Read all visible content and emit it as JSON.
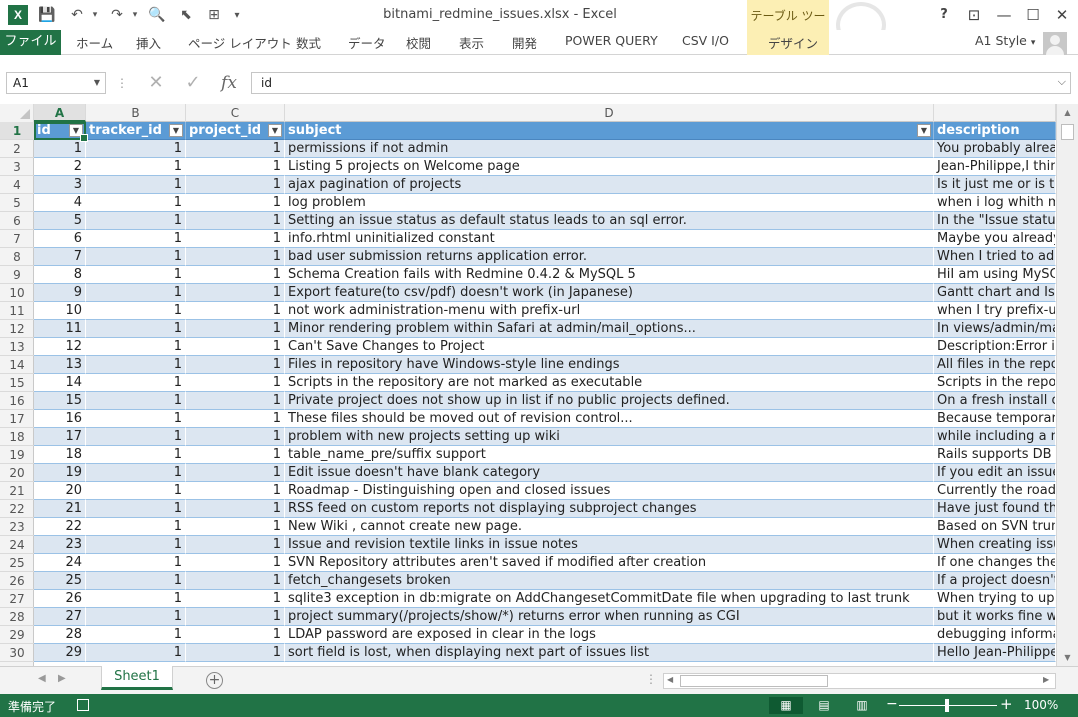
{
  "window": {
    "title": "bitnami_redmine_issues.xlsx - Excel",
    "context_tab_group": "テーブル ツール",
    "help": "?",
    "restore_ribbon": "⊡",
    "minimize": "—",
    "maximize": "☐",
    "close": "✕"
  },
  "quick_access": {
    "app_icon": "X",
    "save": "💾",
    "undo": "↶",
    "redo": "↷",
    "print_preview": "🔍",
    "select": "⬉",
    "screen": "⊞",
    "more": "▾"
  },
  "ribbon": {
    "file": "ファイル",
    "tabs": [
      "ホーム",
      "挿入",
      "ページ レイアウト",
      "数式",
      "データ",
      "校閲",
      "表示",
      "開発",
      "POWER QUERY",
      "CSV I/O",
      "デザイン"
    ],
    "style": "A1 Style",
    "style_arrow": "▾"
  },
  "formula_bar": {
    "name_box": "A1",
    "name_box_arrow": "▼",
    "sep": "⋮",
    "cancel": "✕",
    "enter": "✓",
    "fx": "fx",
    "value": "id",
    "expand": "⌵"
  },
  "grid": {
    "corner": "",
    "columns": [
      "A",
      "B",
      "C",
      "D",
      ""
    ],
    "active_column": "A",
    "active_row": 1,
    "row_numbers": [
      "1",
      "2",
      "3",
      "4",
      "5",
      "6",
      "7",
      "8",
      "9",
      "10",
      "11",
      "12",
      "13",
      "14",
      "15",
      "16",
      "17",
      "18",
      "19",
      "20",
      "21",
      "22",
      "23",
      "24",
      "25",
      "26",
      "27",
      "28",
      "29",
      "30"
    ],
    "headers": [
      "id",
      "tracker_id",
      "project_id",
      "subject",
      "description"
    ],
    "filter_arrow": "▼",
    "rows": [
      [
        "1",
        "1",
        "1",
        "permissions if not admin",
        "You probably alread"
      ],
      [
        "2",
        "1",
        "1",
        "Listing 5 projects on Welcome page",
        "Jean-Philippe,I thin"
      ],
      [
        "3",
        "1",
        "1",
        "ajax pagination of projects",
        "Is it just me or is t"
      ],
      [
        "4",
        "1",
        "1",
        "log problem",
        "when i log whith m"
      ],
      [
        "5",
        "1",
        "1",
        "Setting an issue status as default status leads to an sql error.",
        "In the \"Issue statu"
      ],
      [
        "6",
        "1",
        "1",
        "info.rhtml uninitialized constant",
        "Maybe you already"
      ],
      [
        "7",
        "1",
        "1",
        "bad user submission returns application error.",
        "When I tried to add"
      ],
      [
        "8",
        "1",
        "1",
        "Schema Creation fails with Redmine 0.4.2 & MySQL 5",
        "HiI am using MySQ"
      ],
      [
        "9",
        "1",
        "1",
        "Export feature(to csv/pdf) doesn't work (in Japanese)",
        "Gantt chart and Iss"
      ],
      [
        "10",
        "1",
        "1",
        "not work administration-menu with prefix-url",
        "when I try prefix-u"
      ],
      [
        "11",
        "1",
        "1",
        "Minor rendering problem within Safari at admin/mail_options...",
        "In views/admin/ma"
      ],
      [
        "12",
        "1",
        "1",
        "Can't Save Changes to Project",
        "Description:Error is"
      ],
      [
        "13",
        "1",
        "1",
        "Files in repository have Windows-style line endings",
        "All files in the repo"
      ],
      [
        "14",
        "1",
        "1",
        "Scripts in the repository are not marked as executable",
        "Scripts in the repo"
      ],
      [
        "15",
        "1",
        "1",
        "Private project does not show up in list if no public projects defined.",
        "On a fresh install o"
      ],
      [
        "16",
        "1",
        "1",
        "These files should be moved out of revision control...",
        "Because temporary"
      ],
      [
        "17",
        "1",
        "1",
        "problem with new projects setting up wiki",
        "while including a ne"
      ],
      [
        "18",
        "1",
        "1",
        "table_name_pre/suffix support",
        "Rails supports DB t"
      ],
      [
        "19",
        "1",
        "1",
        "Edit issue doesn't have blank category",
        "If you edit an issue"
      ],
      [
        "20",
        "1",
        "1",
        "Roadmap - Distinguishing open and closed issues",
        "Currently the roadm"
      ],
      [
        "21",
        "1",
        "1",
        "RSS feed on custom reports not displaying subproject changes",
        "Have just found th"
      ],
      [
        "22",
        "1",
        "1",
        "New Wiki , cannot create new page.",
        "Based on SVN trun"
      ],
      [
        "23",
        "1",
        "1",
        "Issue and revision textile links in issue notes",
        "When creating issu"
      ],
      [
        "24",
        "1",
        "1",
        "SVN Repository attributes aren't saved if modified after creation",
        "If one changes the"
      ],
      [
        "25",
        "1",
        "1",
        "fetch_changesets broken",
        "If a project doesn't"
      ],
      [
        "26",
        "1",
        "1",
        "sqlite3 exception in db:migrate on AddChangesetCommitDate file when upgrading to last trunk",
        "When trying to upg"
      ],
      [
        "27",
        "1",
        "1",
        "project summary(/projects/show/*) returns error when running as CGI",
        "but it works fine w"
      ],
      [
        "28",
        "1",
        "1",
        "LDAP password are exposed in clear in the logs",
        "debugging informat"
      ],
      [
        "29",
        "1",
        "1",
        "sort field is lost, when displaying next part of issues list",
        "Hello Jean-Philippe"
      ]
    ]
  },
  "scroll": {
    "up": "▲",
    "down": "▼",
    "left": "◀",
    "right": "▶"
  },
  "sheets": {
    "prev": "◀",
    "next": "▶",
    "tabs": [
      "Sheet1"
    ],
    "add": "+",
    "more": "⋮"
  },
  "status": {
    "text": "準備完了",
    "view_normal": "▦",
    "view_layout": "▤",
    "view_pagebreak": "▥",
    "zoom_minus": "−",
    "zoom_plus": "+",
    "zoom": "100%",
    "zoom_level_percent": 100
  },
  "colors": {
    "excel_green": "#217346",
    "table_header_blue": "#5b9bd5",
    "table_band_blue": "#dce6f1",
    "context_yellow": "#fcefb4"
  }
}
